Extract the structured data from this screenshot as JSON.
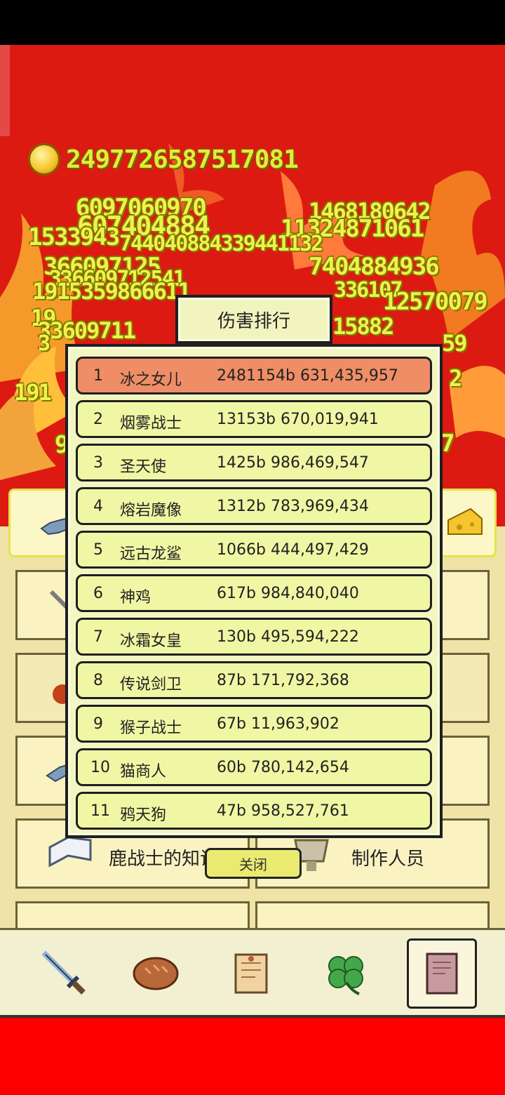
{
  "coins": "2497726587517081",
  "damage_numbers": [
    "6097060970",
    "1468180642",
    "607404884",
    "11324871061",
    "1533943",
    "744040884339441132",
    "366097125",
    "7404884936",
    "336609712541",
    "1915359866611",
    "336107",
    "12570079",
    "19",
    "33609711",
    "15882",
    "3",
    "59",
    "191",
    "2",
    "9",
    "7"
  ],
  "modal": {
    "title": "伤害排行",
    "close": "关闭",
    "rows": [
      {
        "rank": "1",
        "name": "冰之女儿",
        "value": "2481154b 631,435,957"
      },
      {
        "rank": "2",
        "name": "烟雾战士",
        "value": "13153b 670,019,941"
      },
      {
        "rank": "3",
        "name": "圣天使",
        "value": "1425b 986,469,547"
      },
      {
        "rank": "4",
        "name": "熔岩魔像",
        "value": "1312b 783,969,434"
      },
      {
        "rank": "5",
        "name": "远古龙鲨",
        "value": "1066b 444,497,429"
      },
      {
        "rank": "6",
        "name": "神鸡",
        "value": "617b 984,840,040"
      },
      {
        "rank": "7",
        "name": "冰霜女皇",
        "value": "130b 495,594,222"
      },
      {
        "rank": "8",
        "name": "传说剑卫",
        "value": "87b 171,792,368"
      },
      {
        "rank": "9",
        "name": "猴子战士",
        "value": "67b 11,963,902"
      },
      {
        "rank": "10",
        "name": "猫商人",
        "value": "60b 780,142,654"
      },
      {
        "rank": "11",
        "name": "鸦天狗",
        "value": "47b 958,527,761"
      }
    ]
  },
  "menu": {
    "knowledge": "鹿战士的知识",
    "credits": "制作人员"
  },
  "nav": [
    "sword-icon",
    "bread-icon",
    "scroll-icon",
    "clover-icon",
    "book-icon"
  ],
  "colors": {
    "background_red": "#dd1a12",
    "damage_text": "#eef24c",
    "row_bg": "#f0f7a4",
    "row_highlight": "#ef8e66"
  }
}
